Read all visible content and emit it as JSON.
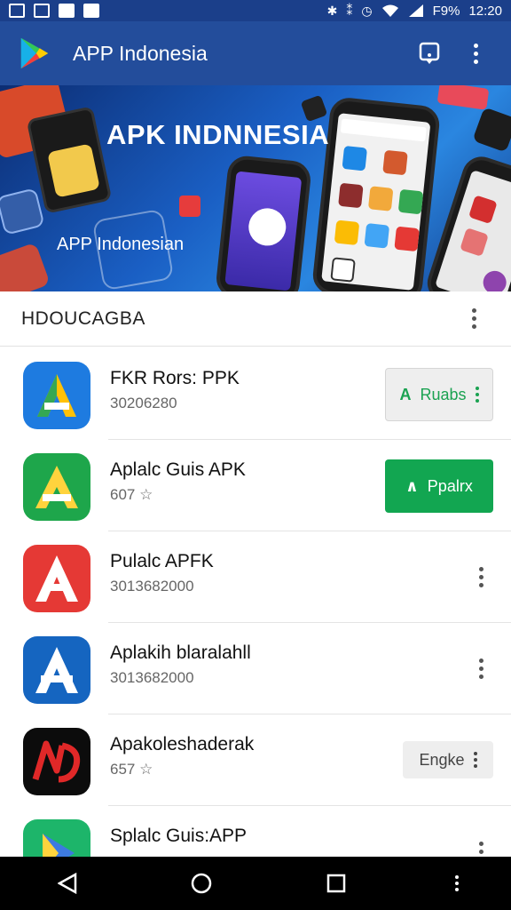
{
  "status_bar": {
    "battery": "F9%",
    "time": "12:20",
    "icons": [
      "gallery-icon",
      "image-icon",
      "sync-icon",
      "notification-icon",
      "bluetooth-icon",
      "vibrate-icon",
      "alarm-icon",
      "wifi-icon",
      "signal-icon"
    ]
  },
  "app_bar": {
    "title": "APP Indonesia",
    "logo_icon": "play-store-logo-icon",
    "action_icon": "notification-bell-icon",
    "menu_icon": "more-vert-icon"
  },
  "banner": {
    "title": "APK INDNNESIA",
    "subtitle": "APP Indonesian"
  },
  "section": {
    "title": "HDOUCAGBA",
    "menu_icon": "more-vert-icon"
  },
  "apps": [
    {
      "name": "FKR Rors: PPK",
      "meta": "30206280",
      "icon": "a-logo-blue-icon",
      "button": {
        "style": "outline",
        "label": "Ruabs"
      }
    },
    {
      "name": "Aplalc Guis APK",
      "meta": "607 ☆",
      "icon": "a-logo-green-icon",
      "button": {
        "style": "green",
        "label": "Ppalrx"
      }
    },
    {
      "name": "Pulalc APFK",
      "meta": "3013682000",
      "icon": "a-logo-red-icon",
      "button": null
    },
    {
      "name": "Aplakih blaralahll",
      "meta": "3013682000",
      "icon": "a-logo-blue-white-icon",
      "button": null
    },
    {
      "name": "Apakoleshaderak",
      "meta": "657 ☆",
      "icon": "nd-logo-black-icon",
      "button": {
        "style": "grey",
        "label": "Engke"
      }
    },
    {
      "name": "Splalc Guis:APP",
      "meta": "",
      "icon": "play-logo-green-icon",
      "button": null
    }
  ],
  "nav_bar": {
    "back_icon": "back-triangle-icon",
    "home_icon": "home-circle-icon",
    "recents_icon": "recents-square-icon",
    "menu_icon": "more-vert-icon"
  },
  "colors": {
    "status_bar": "#1b3f8a",
    "app_bar": "#234d9b",
    "accent_green": "#12a651",
    "banner_blue": "#1a5fc4"
  }
}
